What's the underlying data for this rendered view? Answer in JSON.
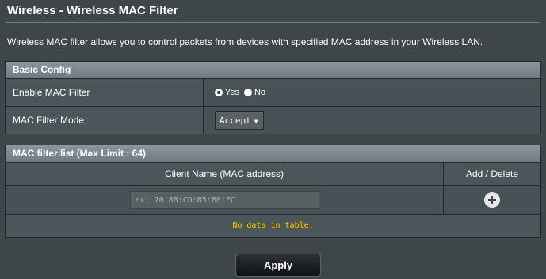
{
  "page": {
    "title": "Wireless - Wireless MAC Filter",
    "description": "Wireless MAC filter allows you to control packets from devices with specified MAC address in your Wireless LAN."
  },
  "basic_config": {
    "header": "Basic Config",
    "enable_label": "Enable MAC Filter",
    "enable_options": [
      "Yes",
      "No"
    ],
    "enable_selected": "Yes",
    "mode_label": "MAC Filter Mode",
    "mode_value": "Accept"
  },
  "mac_list": {
    "header": "MAC filter list (Max Limit : 64)",
    "col_client": "Client Name (MAC address)",
    "col_add": "Add / Delete",
    "input_placeholder": "ex: 70:8B:CD:B5:B0:FC",
    "empty_text": "No data in table."
  },
  "actions": {
    "apply_label": "Apply"
  },
  "icons": {
    "add": "add-circle-icon",
    "dropdown": "chevron-down-icon"
  }
}
